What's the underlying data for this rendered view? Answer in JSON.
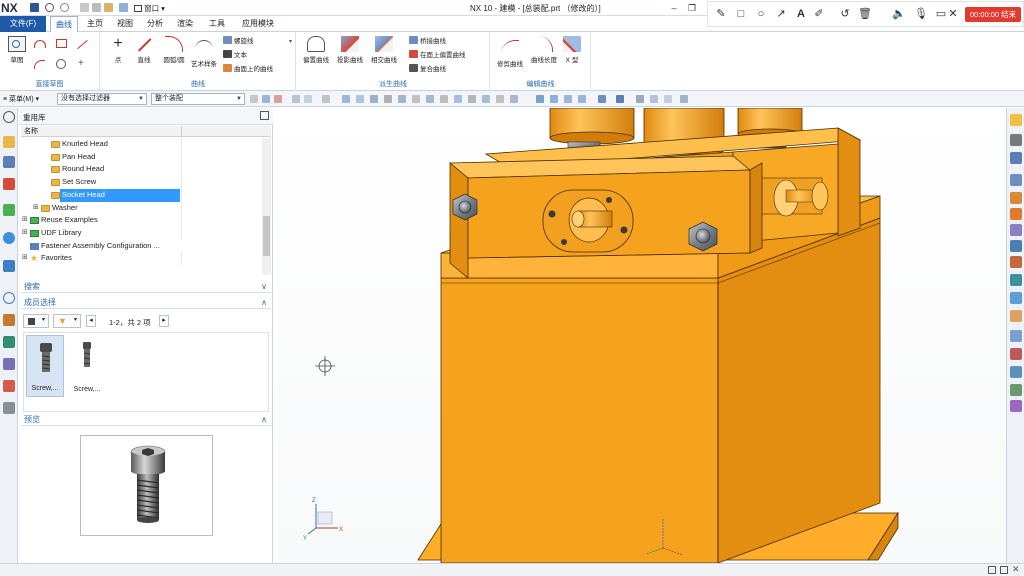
{
  "app": {
    "logo": "NX",
    "title": "NX 10 - 建模 - [总装配.prt  （修改的）]",
    "quick_access_window_label": "窗口",
    "window_controls": {
      "minimize": "–",
      "restore": "❐",
      "close": "✕"
    }
  },
  "recorder": {
    "timer_text": "00:00:00 结束",
    "tools": [
      "pen-icon",
      "rectangle-icon",
      "circle-icon",
      "arrow-icon",
      "text-icon",
      "highlighter-icon",
      "undo-icon",
      "trash-icon",
      "speaker-icon",
      "microphone-icon",
      "camera-icon",
      "close-icon"
    ]
  },
  "menubar": {
    "file_label": "文件(F)",
    "tabs": [
      "曲线",
      "主页",
      "视图",
      "分析",
      "渲染",
      "工具",
      "应用模块"
    ],
    "active_tab": "曲线"
  },
  "ribbon": {
    "groups": {
      "direct_sketch": {
        "label": "直接草图",
        "sketch_button": "草图"
      },
      "curve": {
        "label": "曲线",
        "big_buttons": [
          "点",
          "直线",
          "圆弧/圆",
          "艺术样条"
        ],
        "small_buttons": [
          "螺旋线",
          "文本",
          "曲面上的曲线"
        ]
      },
      "derived_curve": {
        "label": "派生曲线",
        "big_buttons": [
          "偏置曲线",
          "投影曲线",
          "相交曲线"
        ],
        "small_buttons": [
          "桥接曲线",
          "在面上偏置曲线",
          "复合曲线"
        ]
      },
      "edit_curve": {
        "label": "编辑曲线",
        "big_buttons": [
          "修剪曲线",
          "曲线长度",
          "X 型"
        ]
      }
    }
  },
  "toolbar2": {
    "menu_label": "菜单(M)",
    "filter_value": "没有选择过滤器",
    "assembly_value": "整个装配"
  },
  "panel": {
    "title": "重用库",
    "column_header": "名称",
    "tree": [
      {
        "label": "Knurled Head",
        "type": "folder",
        "level": 3,
        "selected": false
      },
      {
        "label": "Pan Head",
        "type": "folder",
        "level": 3,
        "selected": false
      },
      {
        "label": "Round Head",
        "type": "folder",
        "level": 3,
        "selected": false
      },
      {
        "label": "Set Screw",
        "type": "folder",
        "level": 3,
        "selected": false
      },
      {
        "label": "Socket Head",
        "type": "folder",
        "level": 3,
        "selected": true
      },
      {
        "label": "Washer",
        "type": "folder",
        "level": 2,
        "selected": false
      },
      {
        "label": "Reuse Examples",
        "type": "library",
        "level": 1,
        "selected": false
      },
      {
        "label": "UDF Library",
        "type": "library",
        "level": 1,
        "selected": false
      },
      {
        "label": "Fastener Assembly Configuration ...",
        "type": "config",
        "level": 1,
        "selected": false
      },
      {
        "label": "Favorites",
        "type": "favorites",
        "level": 1,
        "selected": false
      }
    ],
    "search_label": "搜索",
    "member_section_label": "成员选择",
    "member_count": "1-2，共 2 项",
    "members": [
      {
        "label": "Screw,...",
        "selected": true
      },
      {
        "label": "Screw,...",
        "selected": false
      }
    ],
    "preview_label": "预览"
  },
  "viewport": {
    "colors": {
      "part_orange": "#f5a21f",
      "part_face_dark": "#e38e10",
      "part_face_light": "#ffb93a",
      "edge": "#4a2d00",
      "nut_gray": "#8a8f96"
    }
  }
}
